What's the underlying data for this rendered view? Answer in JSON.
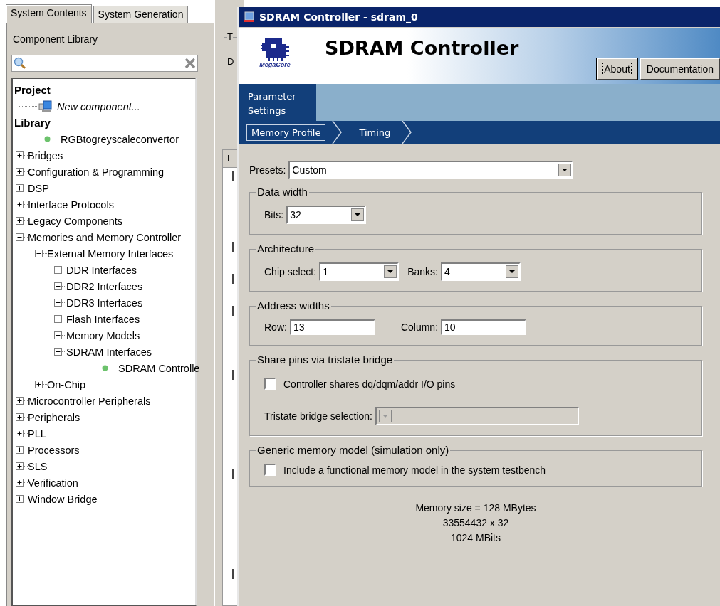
{
  "left_tabs": [
    {
      "label": "System Contents",
      "selected": true
    },
    {
      "label": "System Generation",
      "selected": false
    }
  ],
  "component_library": {
    "title": "Component Library",
    "tree": [
      {
        "label": "Project",
        "items": [
          {
            "label": "New component...",
            "kind": "component"
          }
        ]
      },
      {
        "label": "Library",
        "items": [
          {
            "label": "RGBtogreyscaleconvertor",
            "kind": "leaf"
          },
          {
            "label": "Bridges",
            "kind": "folder",
            "expanded": false
          },
          {
            "label": "Configuration & Programming",
            "kind": "folder",
            "expanded": false
          },
          {
            "label": "DSP",
            "kind": "folder",
            "expanded": false
          },
          {
            "label": "Interface Protocols",
            "kind": "folder",
            "expanded": false
          },
          {
            "label": "Legacy Components",
            "kind": "folder",
            "expanded": false
          },
          {
            "label": "Memories and Memory Controller",
            "kind": "folder",
            "expanded": true,
            "children": [
              {
                "label": "External Memory Interfaces",
                "kind": "folder",
                "expanded": true,
                "children": [
                  {
                    "label": "DDR Interfaces",
                    "kind": "folder",
                    "expanded": false
                  },
                  {
                    "label": "DDR2 Interfaces",
                    "kind": "folder",
                    "expanded": false
                  },
                  {
                    "label": "DDR3 Interfaces",
                    "kind": "folder",
                    "expanded": false
                  },
                  {
                    "label": "Flash Interfaces",
                    "kind": "folder",
                    "expanded": false
                  },
                  {
                    "label": "Memory Models",
                    "kind": "folder",
                    "expanded": false
                  },
                  {
                    "label": "SDRAM Interfaces",
                    "kind": "folder",
                    "expanded": true,
                    "children": [
                      {
                        "label": "SDRAM Controlle",
                        "kind": "leaf"
                      }
                    ]
                  }
                ]
              },
              {
                "label": "On-Chip",
                "kind": "folder",
                "expanded": false
              }
            ]
          },
          {
            "label": "Microcontroller Peripherals",
            "kind": "folder",
            "expanded": false
          },
          {
            "label": "Peripherals",
            "kind": "folder",
            "expanded": false
          },
          {
            "label": "PLL",
            "kind": "folder",
            "expanded": false
          },
          {
            "label": "Processors",
            "kind": "folder",
            "expanded": false
          },
          {
            "label": "SLS",
            "kind": "folder",
            "expanded": false
          },
          {
            "label": "Verification",
            "kind": "folder",
            "expanded": false
          },
          {
            "label": "Window Bridge",
            "kind": "folder",
            "expanded": false
          }
        ]
      }
    ]
  },
  "background_panel": {
    "group_label": "T",
    "text": "D",
    "column_heading": "L"
  },
  "dialog": {
    "title": "SDRAM Controller - sdram_0",
    "logo_text": "MegaCore",
    "heading": "SDRAM Controller",
    "buttons": [
      {
        "label": "About",
        "focused": true
      },
      {
        "label": "Documentation",
        "focused": false
      }
    ],
    "page_tabs": [
      {
        "label": "Parameter Settings",
        "selected": true
      }
    ],
    "steps": [
      {
        "label": "Memory Profile",
        "selected": true
      },
      {
        "label": "Timing",
        "selected": false
      }
    ],
    "presets": {
      "label": "Presets:",
      "value": "Custom"
    },
    "groups": [
      {
        "title": "Data width",
        "rows": [
          [
            {
              "kind": "dropdown",
              "label": "Bits:",
              "value": "32",
              "disabled": false
            }
          ]
        ]
      },
      {
        "title": "Architecture",
        "rows": [
          [
            {
              "kind": "dropdown",
              "label": "Chip select:",
              "value": "1",
              "disabled": false
            },
            {
              "kind": "dropdown",
              "label": "Banks:",
              "value": "4",
              "disabled": false
            }
          ]
        ]
      },
      {
        "title": "Address widths",
        "rows": [
          [
            {
              "kind": "text",
              "label": "Row:",
              "value": "13"
            },
            {
              "kind": "text",
              "label": "Column:",
              "value": "10"
            }
          ]
        ]
      },
      {
        "title": "Share pins via tristate bridge",
        "rows": [
          [
            {
              "kind": "checkbox",
              "label": "Controller shares dq/dqm/addr I/O pins",
              "checked": false
            }
          ],
          [
            {
              "kind": "dropdown",
              "label": "Tristate bridge selection:",
              "disabled": true
            }
          ]
        ]
      },
      {
        "title": "Generic memory model (simulation only)",
        "rows": [
          [
            {
              "kind": "checkbox",
              "label": "Include a functional memory model in the system testbench",
              "checked": false
            }
          ]
        ]
      }
    ],
    "summary": [
      "Memory size = 128 MBytes",
      "33554432 x 32",
      "1024 MBits"
    ]
  }
}
